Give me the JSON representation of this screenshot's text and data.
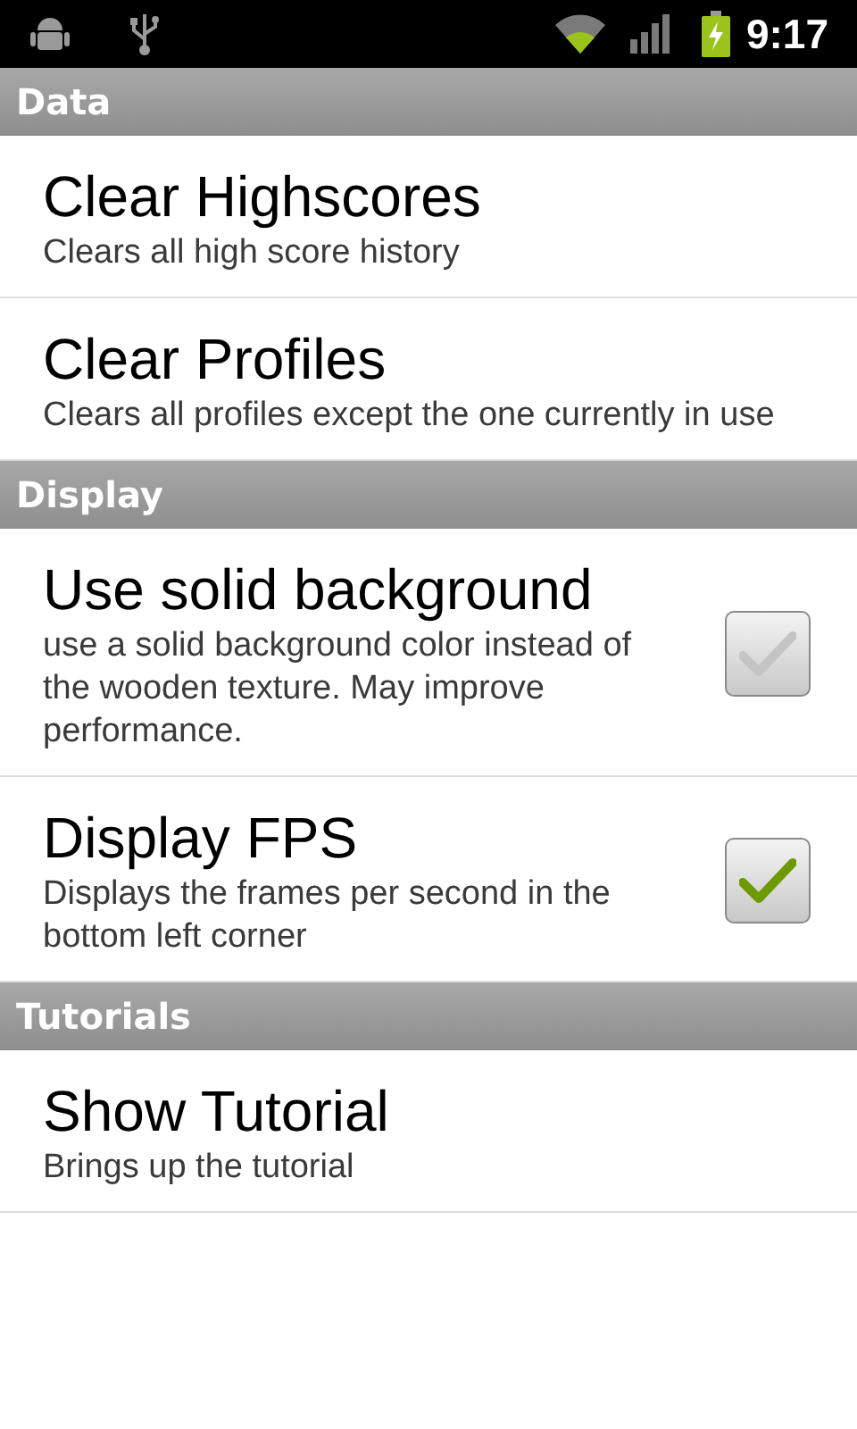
{
  "status_bar": {
    "time": "9:17"
  },
  "sections": [
    {
      "title": "Data",
      "items": [
        {
          "kind": "action",
          "title": "Clear Highscores",
          "summary": "Clears all high score history"
        },
        {
          "kind": "action",
          "title": "Clear Profiles",
          "summary": "Clears all profiles except the one currently in use"
        }
      ]
    },
    {
      "title": "Display",
      "items": [
        {
          "kind": "checkbox",
          "title": "Use solid background",
          "summary": "use a solid background color instead of the wooden texture. May improve performance.",
          "checked": false
        },
        {
          "kind": "checkbox",
          "title": "Display FPS",
          "summary": "Displays the frames per second in the bottom left corner",
          "checked": true
        }
      ]
    },
    {
      "title": "Tutorials",
      "items": [
        {
          "kind": "action",
          "title": "Show Tutorial",
          "summary": "Brings up the tutorial"
        }
      ]
    }
  ]
}
